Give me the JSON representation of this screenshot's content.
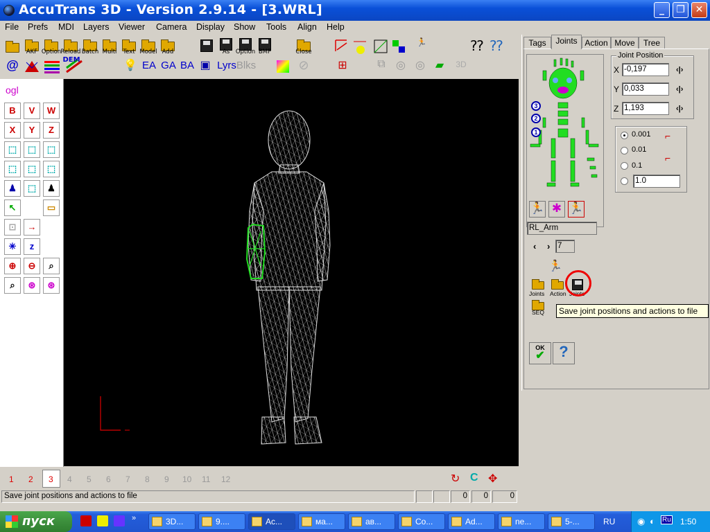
{
  "window": {
    "title": "AccuTrans 3D - Version 2.9.14 - [3.WRL]"
  },
  "menu": [
    "File",
    "Prefs",
    "MDI",
    "Layers",
    "Viewer",
    "Camera",
    "Display",
    "Show",
    "Tools",
    "Align",
    "Help"
  ],
  "toolbar": {
    "labels": [
      "AKF",
      "Option",
      "Reload",
      "Batch",
      "Multi",
      "Text",
      "Model",
      "Add",
      "As",
      "Option",
      "BMP",
      "Close"
    ],
    "row2": [
      "EA",
      "GA",
      "BA",
      "Lyrs",
      "Blks",
      "3D"
    ],
    "dem": "DEM"
  },
  "left_tools": {
    "ogl": "ogl",
    "axis_b": "B",
    "axis_v": "V",
    "axis_w": "W",
    "axis_x": "X",
    "axis_y": "Y",
    "axis_z": "Z"
  },
  "panel": {
    "tabs": [
      "Tags",
      "Joints",
      "Action",
      "Move",
      "Tree"
    ],
    "active_tab": "Joints",
    "joint_position": {
      "title": "Joint Position",
      "x_label": "X",
      "y_label": "Y",
      "z_label": "Z",
      "x": "-0,197",
      "y": "0,033",
      "z": "1,193"
    },
    "steps": {
      "options": [
        "0.001",
        "0.01",
        "0.1"
      ],
      "custom": "1.0",
      "selected": "0.001"
    },
    "bone_numbers": [
      "3",
      "2",
      "1"
    ],
    "joint_name": "RL_Arm",
    "index": "7",
    "buttons": {
      "joints": "Joints",
      "action": "Action",
      "save": "Joints",
      "seq": "SEQ",
      "ok": "OK",
      "help": "?"
    },
    "tooltip": "Save joint positions and actions to file"
  },
  "viewports": {
    "numbers": [
      "1",
      "2",
      "3",
      "4",
      "5",
      "6",
      "7",
      "8",
      "9",
      "10",
      "11",
      "12"
    ],
    "active": "3"
  },
  "status": {
    "text": "Save joint positions and actions to file",
    "values": [
      "0",
      "0",
      "0"
    ]
  },
  "taskbar": {
    "start": "пуск",
    "tasks": [
      "3D...",
      "9....",
      "Ac...",
      "ма...",
      "ав...",
      "Co...",
      "Ad...",
      "ne...",
      "5-..."
    ],
    "lang": "RU",
    "tray_lang": "Ru",
    "clock": "1:50"
  },
  "colors": {
    "title_blue": "#0a50d8",
    "viewport_bg": "#000000",
    "wire": "#d8d8d8",
    "highlight": "#22dd22",
    "red_circle": "#e00000"
  }
}
